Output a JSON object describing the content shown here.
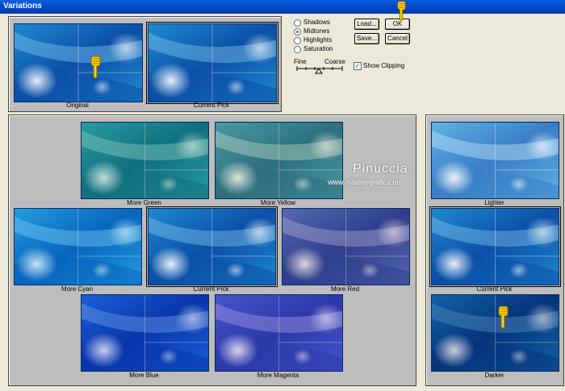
{
  "window": {
    "title": "Variations"
  },
  "preview": {
    "original": "Original",
    "current_pick": "Current Pick"
  },
  "options": {
    "radios": [
      {
        "label": "Shadows",
        "checked": false
      },
      {
        "label": "Midtones",
        "checked": true
      },
      {
        "label": "Highlights",
        "checked": false
      },
      {
        "label": "Saturation",
        "checked": false
      }
    ],
    "fine_label": "Fine",
    "coarse_label": "Coarse",
    "show_clipping": "Show Clipping",
    "show_clipping_checked": true
  },
  "buttons": {
    "load": "Load...",
    "save": "Save...",
    "ok": "OK",
    "cancel": "Cancel"
  },
  "variations": {
    "more_green": "More Green",
    "more_yellow": "More Yellow",
    "more_cyan": "More Cyan",
    "current_pick": "Current Pick",
    "more_red": "More Red",
    "more_blue": "More Blue",
    "more_magenta": "More Magenta"
  },
  "brightness": {
    "lighter": "Lighter",
    "current_pick": "Current Pick",
    "darker": "Darker"
  },
  "watermark": {
    "name": "Pinuccia",
    "url": "www.maidiregrafica.eu"
  },
  "colors": {
    "titlebar": "#0046c8",
    "dialog_bg": "#ece9d8",
    "panel_bg": "#bdbdbd"
  }
}
